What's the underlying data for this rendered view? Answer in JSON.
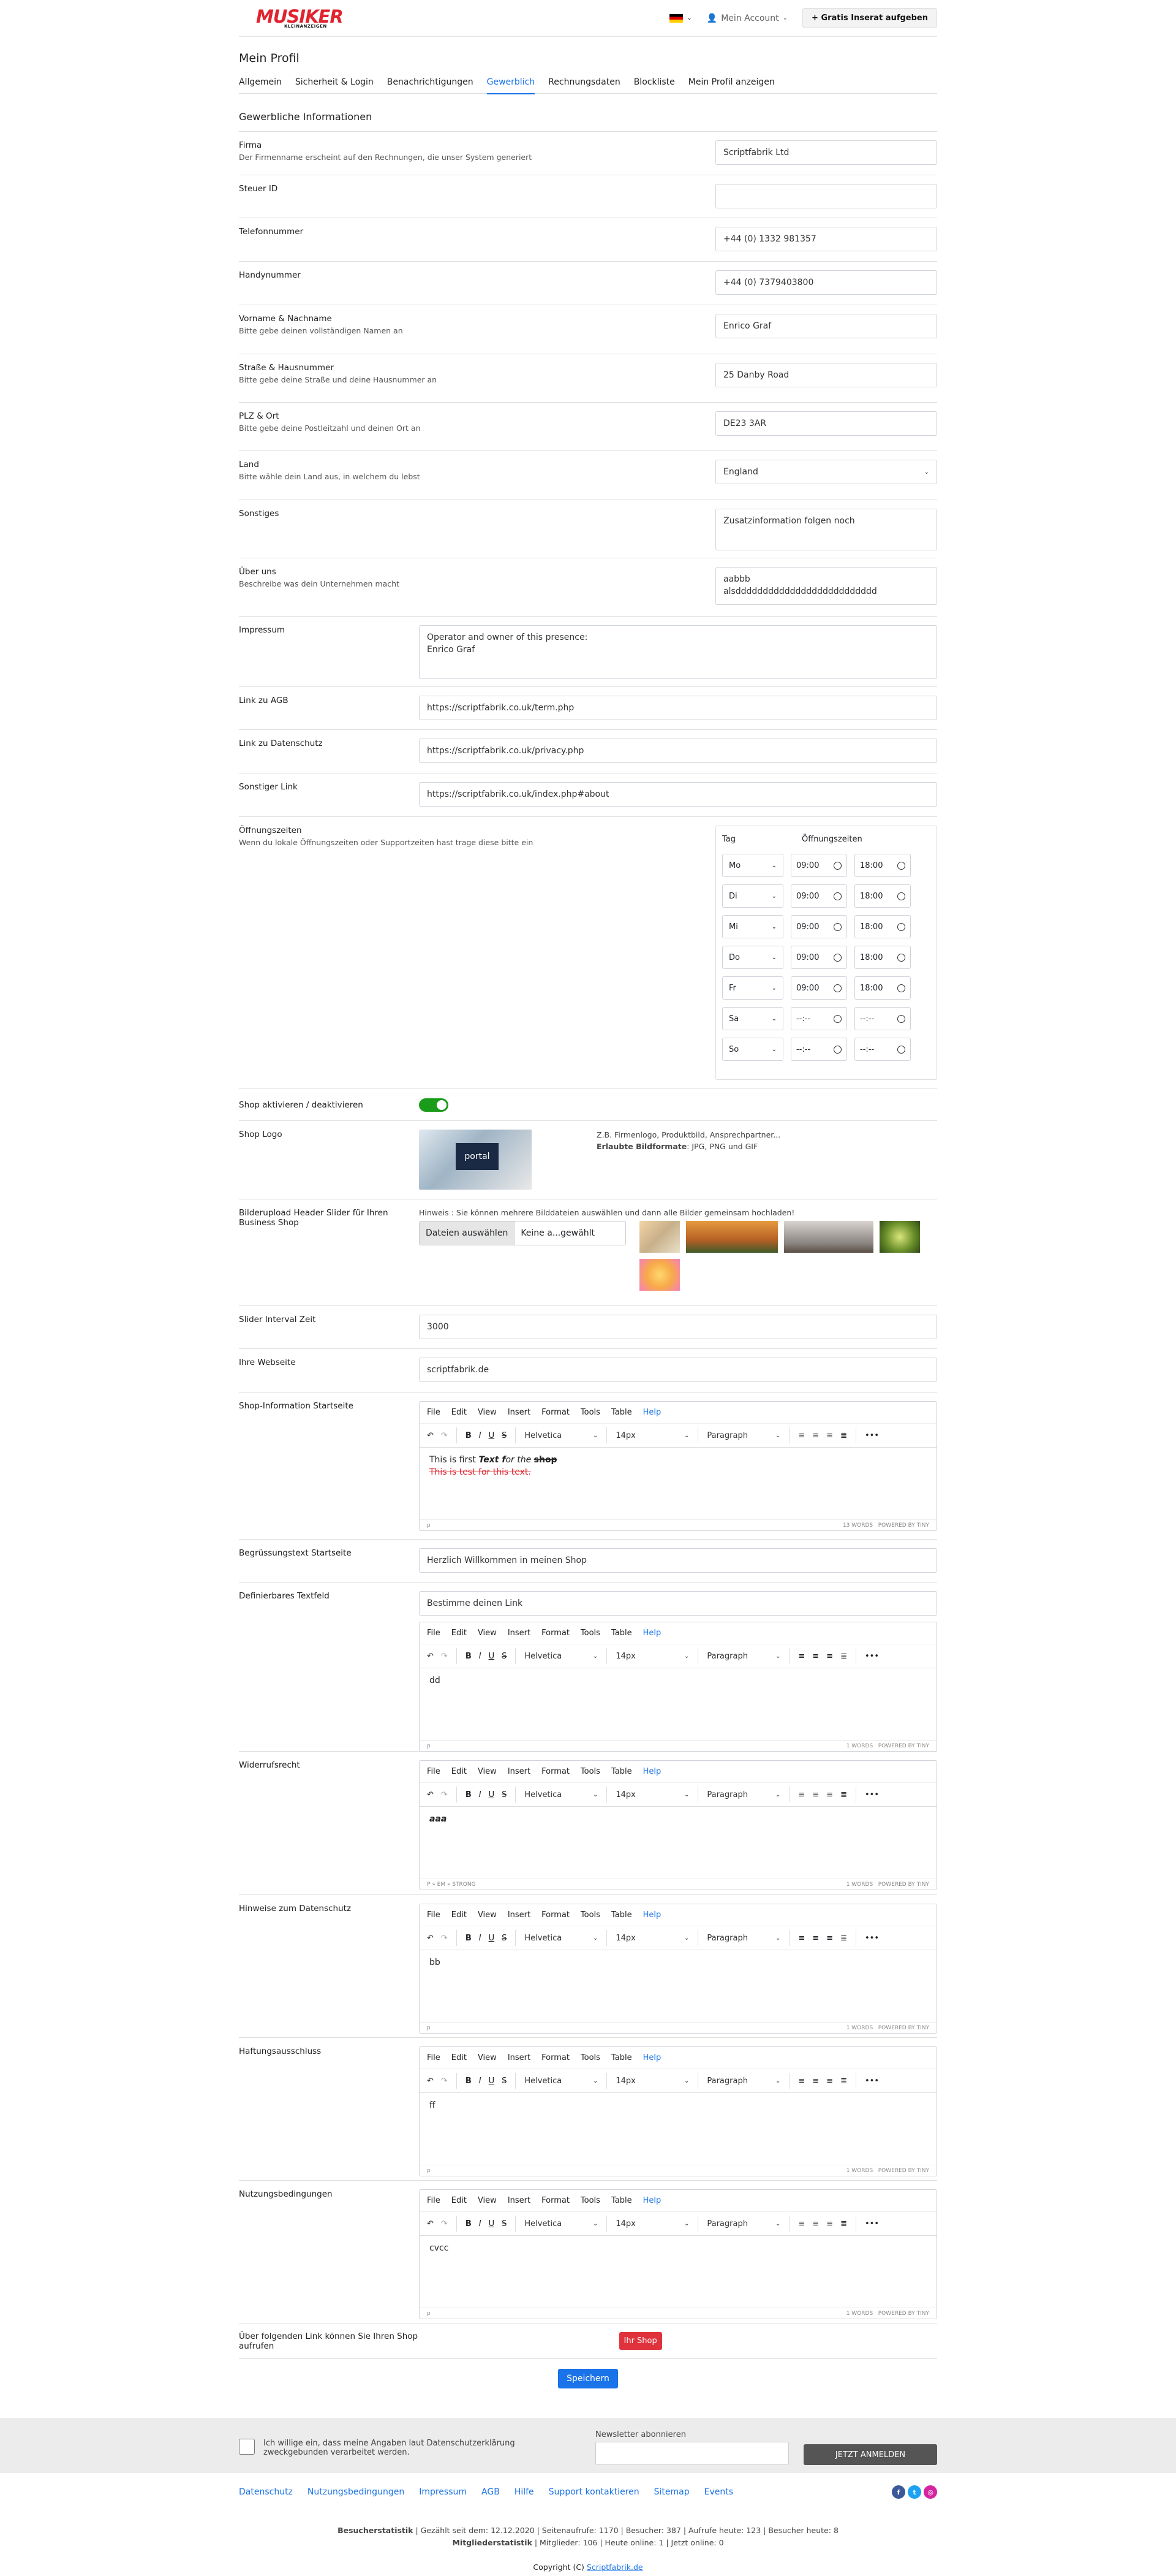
{
  "header": {
    "logo": "MUSIKER",
    "logo_sub": "KLEINANZEIGEN",
    "account": "Mein Account",
    "cta": "Gratis Inserat aufgeben"
  },
  "page": {
    "title": "Mein Profil"
  },
  "tabs": [
    {
      "label": "Allgemein"
    },
    {
      "label": "Sicherheit & Login"
    },
    {
      "label": "Benachrichtigungen"
    },
    {
      "label": "Gewerblich"
    },
    {
      "label": "Rechnungsdaten"
    },
    {
      "label": "Blockliste"
    },
    {
      "label": "Mein Profil anzeigen"
    }
  ],
  "section": "Gewerbliche Informationen",
  "fields": {
    "firma": {
      "label": "Firma",
      "desc": "Der Firmenname erscheint auf den Rechnungen, die unser System generiert",
      "value": "Scriptfabrik Ltd"
    },
    "steuer": {
      "label": "Steuer ID",
      "value": ""
    },
    "tel": {
      "label": "Telefonnummer",
      "value": "+44 (0) 1332 981357"
    },
    "handy": {
      "label": "Handynummer",
      "value": "+44 (0) 7379403800"
    },
    "name": {
      "label": "Vorname & Nachname",
      "desc": "Bitte gebe deinen vollständigen Namen an",
      "value": "Enrico Graf"
    },
    "strasse": {
      "label": "Straße & Hausnummer",
      "desc": "Bitte gebe deine Straße und deine Hausnummer an",
      "value": "25 Danby Road"
    },
    "plz": {
      "label": "PLZ & Ort",
      "desc": "Bitte gebe deine Postleitzahl und deinen Ort an",
      "value": "DE23 3AR"
    },
    "land": {
      "label": "Land",
      "desc": "Bitte wähle dein Land aus, in welchem du lebst",
      "value": "England"
    },
    "sonstiges": {
      "label": "Sonstiges",
      "value": "Zusatzinformation folgen noch"
    },
    "ueber": {
      "label": "Über uns",
      "desc": "Beschreibe was dein Unternehmen macht",
      "value": "aabbb\nalsdddddddddddddddddddddddddd"
    },
    "impressum": {
      "label": "Impressum",
      "value": "Operator and owner of this presence:\nEnrico Graf"
    },
    "agb": {
      "label": "Link zu AGB",
      "value": "https://scriptfabrik.co.uk/term.php"
    },
    "datenschutz": {
      "label": "Link zu Datenschutz",
      "value": "https://scriptfabrik.co.uk/privacy.php"
    },
    "sonstlink": {
      "label": "Sonstiger Link",
      "value": "https://scriptfabrik.co.uk/index.php#about"
    }
  },
  "hours": {
    "label": "Öffnungszeiten",
    "desc": "Wenn du lokale Öffnungszeiten oder Supportzeiten hast trage diese bitte ein",
    "col_day": "Tag",
    "col_time": "Öffnungszeiten",
    "days": [
      {
        "day": "Mo",
        "from": "09:00",
        "to": "18:00"
      },
      {
        "day": "Di",
        "from": "09:00",
        "to": "18:00"
      },
      {
        "day": "Mi",
        "from": "09:00",
        "to": "18:00"
      },
      {
        "day": "Do",
        "from": "09:00",
        "to": "18:00"
      },
      {
        "day": "Fr",
        "from": "09:00",
        "to": "18:00"
      },
      {
        "day": "Sa",
        "from": "--:--",
        "to": "--:--"
      },
      {
        "day": "So",
        "from": "--:--",
        "to": "--:--"
      }
    ]
  },
  "shop": {
    "toggle_label": "Shop aktivieren / deaktivieren",
    "logo_label": "Shop Logo",
    "logo_hint": "Z.B. Firmenlogo, Produktbild, Ansprechpartner...",
    "logo_formats_label": "Erlaubte Bildformate",
    "logo_formats": ": JPG, PNG und GIF",
    "logo_img_text": "portal",
    "slider_label": "Bilderupload Header Slider für Ihren Business Shop",
    "slider_hint": "Hinweis : Sie können mehrere Bilddateien auswählen und dann alle Bilder gemeinsam hochladen!",
    "file_btn": "Dateien auswählen",
    "file_none": "Keine a...gewählt",
    "interval_label": "Slider Interval Zeit",
    "interval_value": "3000",
    "web_label": "Ihre Webseite",
    "web_value": "scriptfabrik.de",
    "info_label": "Shop-Information Startseite",
    "greet_label": "Begrüssungstext Startseite",
    "greet_value": "Herzlich Willkommen in meinen Shop",
    "custom_label": "Definierbares Textfeld",
    "custom_value": "Bestimme deinen Link",
    "widerruf_label": "Widerrufsrecht",
    "hinweise_label": "Hinweise zum Datenschutz",
    "haftung_label": "Haftungsausschluss",
    "nutzung_label": "Nutzungsbedingungen",
    "link_label": "Über folgenden Link können Sie Ihren Shop aufrufen",
    "link_btn": "Ihr Shop",
    "save": "Speichern"
  },
  "editor": {
    "menu": [
      "File",
      "Edit",
      "View",
      "Insert",
      "Format",
      "Tools",
      "Table",
      "Help"
    ],
    "font": "Helvetica",
    "size": "14px",
    "block": "Paragraph",
    "powered": "POWERED BY TINY",
    "info_line1_a": "This is first ",
    "info_line1_b": "Text f",
    "info_line1_c": "or the ",
    "info_line1_d": "shop",
    "info_line2": "This is test for this text.",
    "info_words": "13 WORDS",
    "info_path": "p",
    "custom_body": "dd",
    "custom_words": "1 WORDS",
    "custom_path": "p",
    "widerruf_body": "aaa",
    "widerruf_words": "1 WORDS",
    "widerruf_path": "P » EM » STRONG",
    "hinweise_body": "bb",
    "hinweise_words": "1 WORDS",
    "hinweise_path": "p",
    "haftung_body": "ff",
    "haftung_words": "1 WORDS",
    "haftung_path": "p",
    "nutzung_body": "cvcc",
    "nutzung_words": "1 WORDS",
    "nutzung_path": "p"
  },
  "footer": {
    "consent": "Ich willige ein, dass meine Angaben laut Datenschutzerklärung zweckgebunden verarbeitet werden.",
    "newsletter_label": "Newsletter abonnieren",
    "newsletter_btn": "JETZT ANMELDEN",
    "links": [
      "Datenschutz",
      "Nutzungsbedingungen",
      "Impressum",
      "AGB",
      "Hilfe",
      "Support kontaktieren",
      "Sitemap",
      "Events"
    ],
    "stats_title": "Besucherstatistik",
    "stats": "| Gezählt seit dem: 12.12.2020 | Seitenaufrufe: 1170 | Besucher: 387 | Aufrufe heute: 123 | Besucher heute: 8",
    "member_title": "Mitgliederstatistik",
    "member": "| Mitglieder: 106 | Heute online: 1 | Jetzt online: 0",
    "copy_a": "Copyright (C) ",
    "copy_link": "Scriptfabrik.de"
  }
}
